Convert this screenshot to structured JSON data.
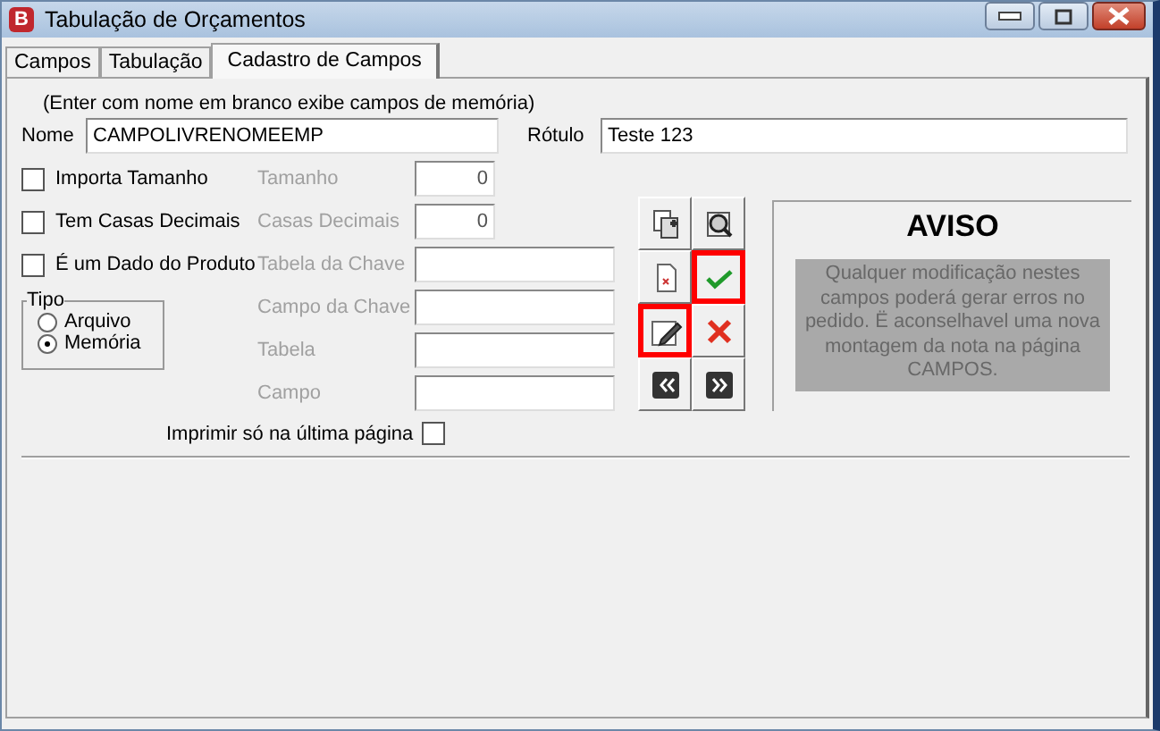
{
  "window": {
    "title": "Tabulação de Orçamentos",
    "icon_letter": "B"
  },
  "tabs": [
    {
      "label": "Campos",
      "selected": false
    },
    {
      "label": "Tabulação",
      "selected": false
    },
    {
      "label": "Cadastro de Campos",
      "selected": true
    }
  ],
  "hint": "(Enter com nome em branco exibe campos de memória)",
  "nome": {
    "label": "Nome",
    "value": "CAMPOLIVRENOMEEMP"
  },
  "rotulo": {
    "label": "Rótulo",
    "value": "Teste 123"
  },
  "checkboxes": [
    {
      "label": "Importa Tamanho",
      "checked": false
    },
    {
      "label": "Tem Casas Decimais",
      "checked": false
    },
    {
      "label": "É um Dado do Produto",
      "checked": false
    }
  ],
  "fields": [
    {
      "label": "Tamanho",
      "value": "0",
      "kind": "number",
      "disabled": true
    },
    {
      "label": "Casas Decimais",
      "value": "0",
      "kind": "number",
      "disabled": true
    },
    {
      "label": "Tabela da Chave",
      "kind": "text",
      "disabled": true
    },
    {
      "label": "Campo da Chave",
      "kind": "text",
      "disabled": true
    },
    {
      "label": "Tabela",
      "kind": "text",
      "disabled": true
    },
    {
      "label": "Campo",
      "kind": "text",
      "disabled": true
    }
  ],
  "tipo": {
    "label": "Tipo",
    "options": [
      {
        "label": "Arquivo",
        "selected": false
      },
      {
        "label": "Memória",
        "selected": true
      }
    ]
  },
  "imprimir": {
    "label": "Imprimir só na última página",
    "checked": false
  },
  "buttons": [
    {
      "kind": "copy",
      "highlighted": false
    },
    {
      "kind": "search",
      "highlighted": false
    },
    {
      "kind": "delete",
      "highlighted": false
    },
    {
      "kind": "confirm",
      "highlighted": true
    },
    {
      "kind": "edit",
      "highlighted": true
    },
    {
      "kind": "cancel",
      "highlighted": false
    },
    {
      "kind": "first",
      "highlighted": false
    },
    {
      "kind": "last",
      "highlighted": false
    }
  ],
  "aviso": {
    "title": "AVISO",
    "message": "Qualquer modificação nestes campos poderá gerar erros no pedido. Ë aconselhavel uma nova montagem da nota na página CAMPOS."
  }
}
